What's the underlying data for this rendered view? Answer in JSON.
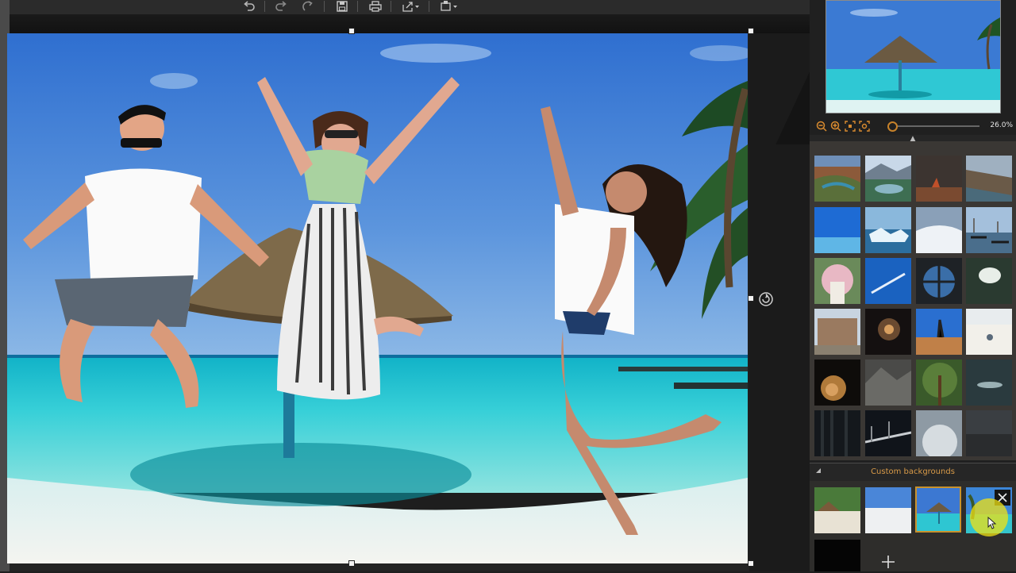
{
  "app": {
    "toolbar_icons": [
      "undo-icon",
      "redo-icon",
      "redo-alt-icon",
      "save-icon",
      "print-icon",
      "export-icon",
      "share-icon"
    ]
  },
  "canvas": {
    "scene": "beach with straw umbrella and palm tree",
    "subjects": [
      "jumping man in white t-shirt and sunglasses",
      "jumping woman in striped dress and scarf",
      "jumping woman in white top"
    ]
  },
  "navigator": {
    "zoom_value": "26.0%",
    "zoom_level": 0.26,
    "zoom_icons": [
      "zoom-out-icon",
      "zoom-in-icon",
      "fit-icon",
      "actual-size-icon"
    ]
  },
  "backgrounds": {
    "rows": [
      [
        "canyon",
        "mountain-lake",
        "desert-storm",
        "coastal-cliff"
      ],
      [
        "blue-sky-sea",
        "ice-floes",
        "snowy-hills",
        "venice-gondolas"
      ],
      [
        "flower-arch",
        "sand-writing",
        "space-window",
        "tunnel-light"
      ],
      [
        "old-street",
        "dark-cave",
        "desert-person",
        "white-sand"
      ],
      [
        "lion",
        "rocks",
        "tree-top",
        "underwater"
      ],
      [
        "dark-forest",
        "night-bridge",
        "planet",
        "dark-room"
      ]
    ]
  },
  "custom_backgrounds": {
    "label": "Custom backgrounds",
    "items": [
      "beach-huts",
      "white-beach",
      "beach-umbrella",
      "palm-beach"
    ],
    "selected_index": 2,
    "add_icon": "plus-icon",
    "close_icon": "close-icon"
  },
  "colors": {
    "accent": "#d89a48",
    "panel_bg": "#202020",
    "grid_bg": "#3a3734"
  }
}
